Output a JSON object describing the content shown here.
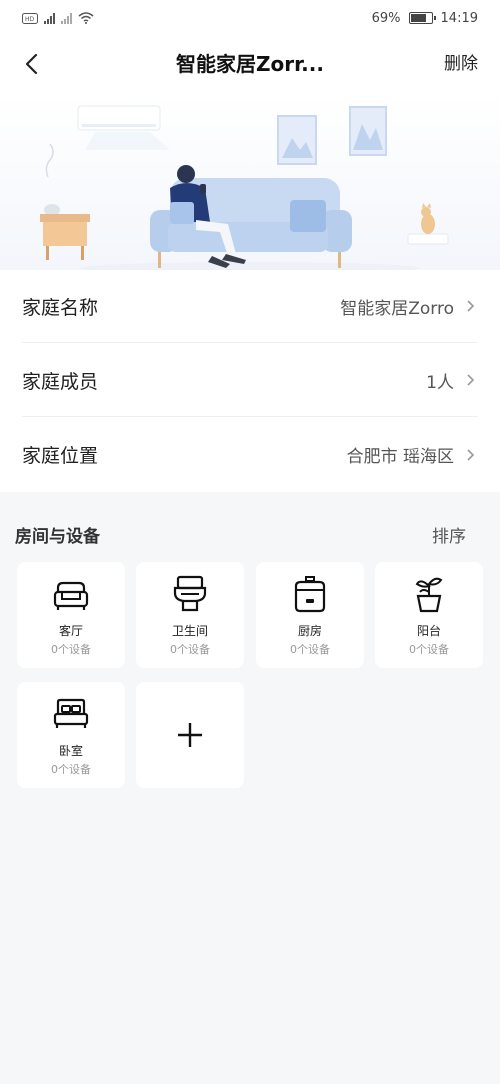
{
  "status_bar": {
    "left_icons": [
      "nfc-icon",
      "4g-signal-icon",
      "no-signal-icon",
      "wifi-icon"
    ],
    "battery": "69%",
    "battery_level": 0.69,
    "time": "14:19"
  },
  "nav": {
    "title": "智能家居Zorr...",
    "delete_label": "删除"
  },
  "info_rows": [
    {
      "label": "家庭名称",
      "value": "智能家居Zorro"
    },
    {
      "label": "家庭成员",
      "value": "1人"
    },
    {
      "label": "家庭位置",
      "value": "合肥市 瑶海区"
    }
  ],
  "rooms_section": {
    "title": "房间与设备",
    "sort_label": "排序",
    "rooms": [
      {
        "name": "客厅",
        "count": "0个设备",
        "icon": "sofa-icon"
      },
      {
        "name": "卫生间",
        "count": "0个设备",
        "icon": "toilet-icon"
      },
      {
        "name": "厨房",
        "count": "0个设备",
        "icon": "rice-cooker-icon"
      },
      {
        "name": "阳台",
        "count": "0个设备",
        "icon": "plant-icon"
      },
      {
        "name": "卧室",
        "count": "0个设备",
        "icon": "bed-icon"
      }
    ],
    "add_icon": "plus-icon"
  },
  "colors": {
    "page_bg": "#f6f7f9",
    "card_bg": "#ffffff",
    "sofa": "#bfd3ef",
    "text_primary": "#222222",
    "text_secondary": "#999999"
  }
}
